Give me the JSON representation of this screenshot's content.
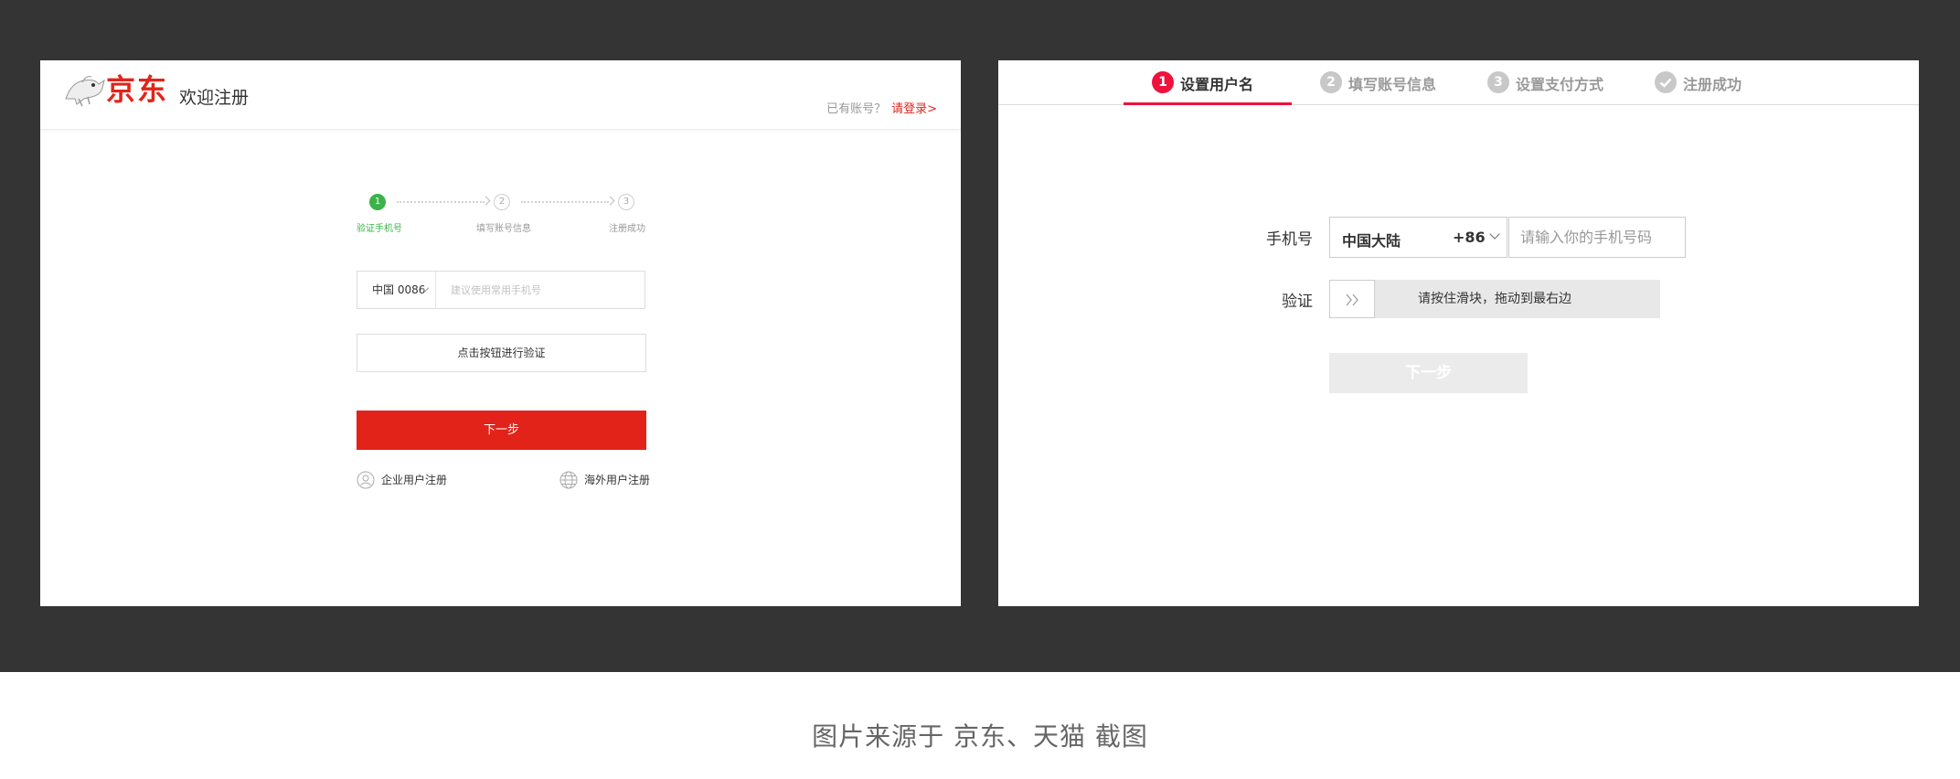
{
  "jd": {
    "logo_text": "京东",
    "welcome": "欢迎注册",
    "login_prompt": "已有账号？",
    "login_link": "请登录>",
    "steps": [
      {
        "num": "1",
        "label": "验证手机号"
      },
      {
        "num": "2",
        "label": "填写账号信息"
      },
      {
        "num": "3",
        "label": "注册成功"
      }
    ],
    "country_code": "中国 0086",
    "phone_placeholder": "建议使用常用手机号",
    "verify_button": "点击按钮进行验证",
    "next_button": "下一步",
    "enterprise_link": "企业用户注册",
    "overseas_link": "海外用户注册",
    "colors": {
      "brand": "#e1251b",
      "step_active": "#3bb34a"
    }
  },
  "tmall": {
    "tabs": [
      {
        "num": "1",
        "label": "设置用户名"
      },
      {
        "num": "2",
        "label": "填写账号信息"
      },
      {
        "num": "3",
        "label": "设置支付方式"
      },
      {
        "num": "check-icon",
        "label": "注册成功"
      }
    ],
    "phone_label": "手机号",
    "region_name": "中国大陆",
    "region_code": "+86",
    "phone_placeholder": "请输入你的手机号码",
    "verify_label": "验证",
    "slider_text": "请按住滑块，拖动到最右边",
    "next_button": "下一步",
    "colors": {
      "brand": "#f0113c"
    }
  },
  "caption": "图片来源于 京东、天猫 截图"
}
